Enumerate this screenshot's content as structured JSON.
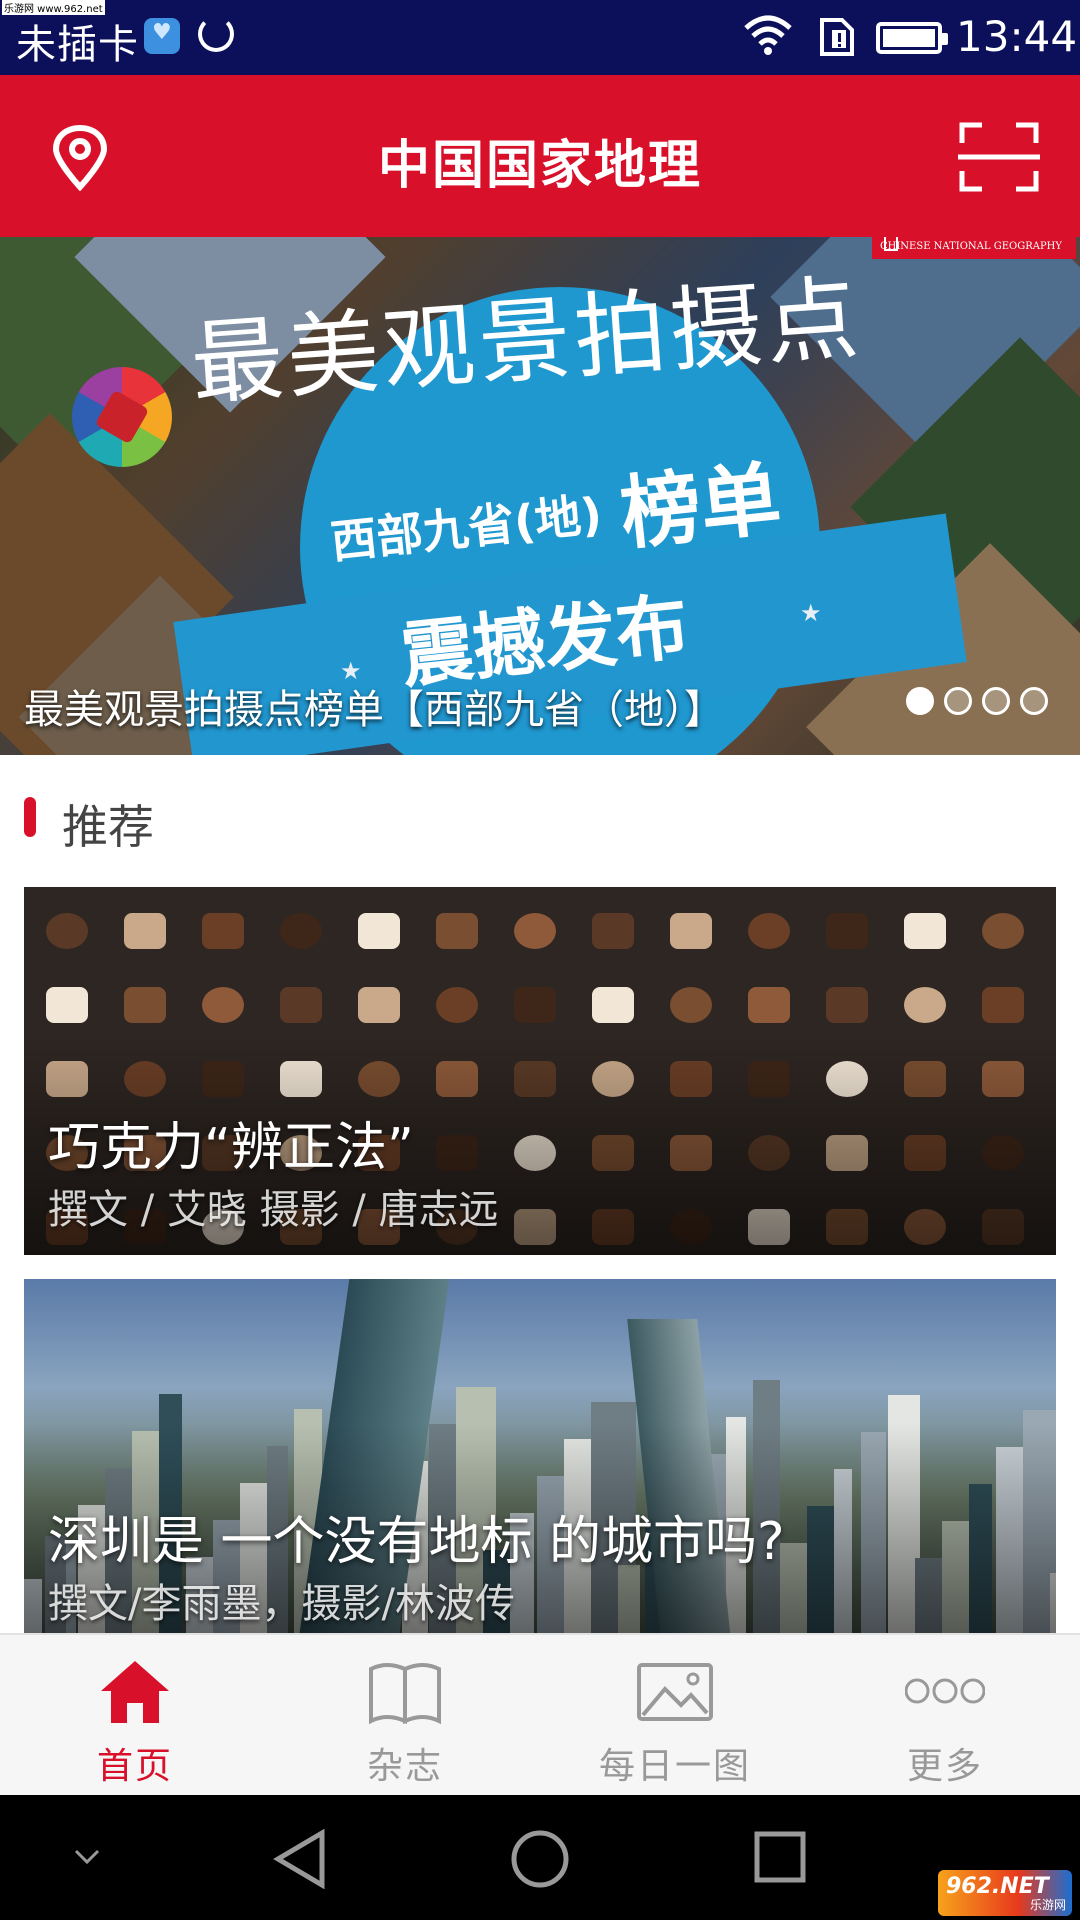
{
  "status_bar": {
    "carrier": "未插卡",
    "time": "13:44",
    "watermark": "乐游网 www.962.net"
  },
  "app_bar": {
    "title": "中国国家地理"
  },
  "banner": {
    "headline": "最美观景拍摄点",
    "sub_region": "西部九省(地)",
    "sub_list": "榜单",
    "sub_release": "震撼发布",
    "brand": "CHINESE NATIONAL GEOGRAPHY",
    "caption": "最美观景拍摄点榜单【西部九省（地）】",
    "slide_count": 4,
    "active_slide": 1
  },
  "section": {
    "title": "推荐"
  },
  "cards": [
    {
      "title": "巧克力“辨正法”",
      "credit": "撰文 / 艾晓    摄影 / 唐志远"
    },
    {
      "title": "深圳是 一个没有地标 的城市吗?",
      "credit": "撰文/李雨墨，摄影/林波传"
    }
  ],
  "bottom_nav": {
    "items": [
      {
        "label": "首页",
        "icon": "home-icon",
        "active": true
      },
      {
        "label": "杂志",
        "icon": "book-icon",
        "active": false
      },
      {
        "label": "每日一图",
        "icon": "image-icon",
        "active": false
      },
      {
        "label": "更多",
        "icon": "more-icon",
        "active": false
      }
    ]
  },
  "corner_logo": {
    "text": "962.NET",
    "sub": "乐游网"
  },
  "colors": {
    "brand_red": "#d8102a",
    "status_bar": "#0c0f5a",
    "nav_inactive": "#999999"
  }
}
